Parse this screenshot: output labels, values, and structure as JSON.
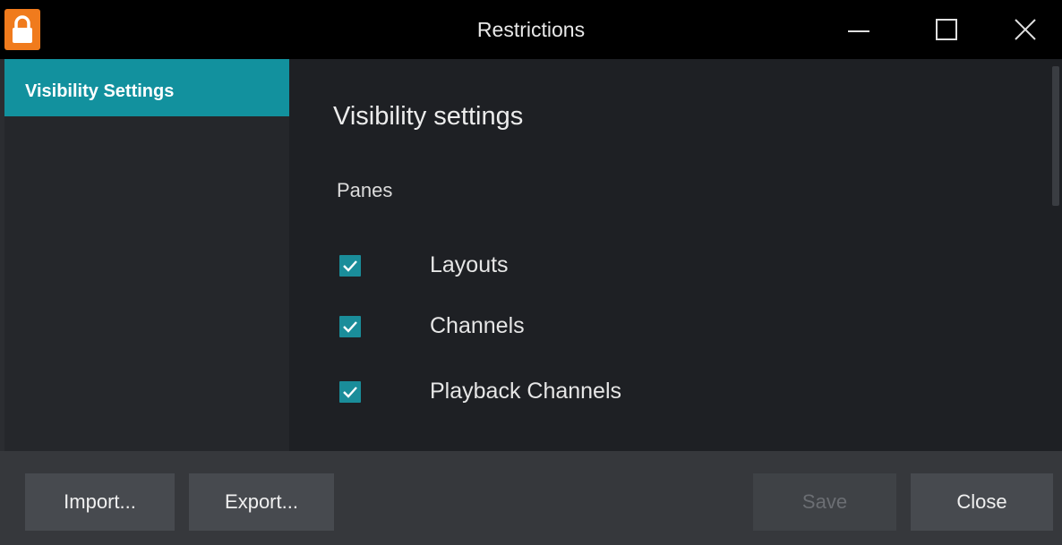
{
  "window": {
    "title": "Restrictions",
    "app_icon": "padlock-icon",
    "controls": [
      "minimize-icon",
      "maximize-icon",
      "close-icon"
    ]
  },
  "sidebar": {
    "items": [
      {
        "label": "Visibility Settings",
        "selected": true
      }
    ]
  },
  "main": {
    "section_title": "Visibility settings",
    "group_label": "Panes",
    "checkboxes": [
      {
        "label": "Layouts",
        "checked": true
      },
      {
        "label": "Channels",
        "checked": true
      },
      {
        "label": "Playback Channels",
        "checked": true
      }
    ]
  },
  "footer": {
    "import_label": "Import...",
    "export_label": "Export...",
    "save_label": "Save",
    "save_enabled": false,
    "close_label": "Close"
  },
  "colors": {
    "accent": "#12919e",
    "app_icon": "#f07b1d",
    "titlebar": "#000000"
  }
}
